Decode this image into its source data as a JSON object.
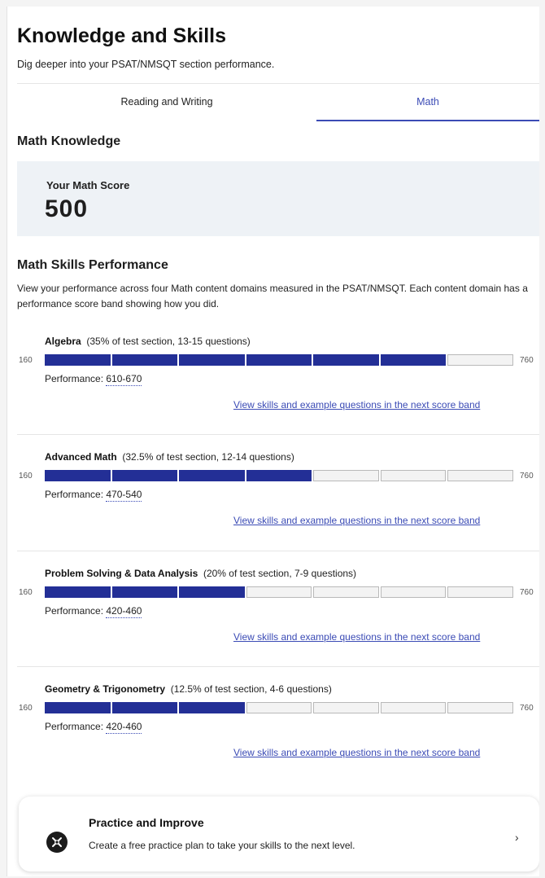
{
  "header": {
    "title": "Knowledge and Skills",
    "subtitle": "Dig deeper into your PSAT/NMSQT section performance."
  },
  "tabs": [
    {
      "label": "Reading and Writing",
      "active": false
    },
    {
      "label": "Math",
      "active": true
    }
  ],
  "math_knowledge": {
    "heading": "Math Knowledge",
    "score_label": "Your Math Score",
    "score_value": "500"
  },
  "skills": {
    "heading": "Math Skills Performance",
    "description": "View your performance across four Math content domains measured in the PSAT/NMSQT. Each content domain has a performance score band showing how you did.",
    "scale_min": "160",
    "scale_max": "760",
    "performance_label": "Performance:",
    "link_text": "View skills and example questions in the next score band",
    "domains": [
      {
        "name": "Algebra",
        "details": "(35% of test section, 13-15 questions)",
        "band": "610-670",
        "filled_segments": 6,
        "total_segments": 7
      },
      {
        "name": "Advanced Math",
        "details": "(32.5% of test section, 12-14 questions)",
        "band": "470-540",
        "filled_segments": 4,
        "total_segments": 7
      },
      {
        "name": "Problem Solving & Data Analysis",
        "details": "(20% of test section, 7-9 questions)",
        "band": "420-460",
        "filled_segments": 3,
        "total_segments": 7
      },
      {
        "name": "Geometry & Trigonometry",
        "details": "(12.5% of test section, 4-6 questions)",
        "band": "420-460",
        "filled_segments": 3,
        "total_segments": 7
      }
    ]
  },
  "practice": {
    "title": "Practice and Improve",
    "subtitle": "Create a free practice plan to take your skills to the next level.",
    "icon": "practice-plan-icon",
    "chevron": "chevron-right-icon"
  },
  "colors": {
    "accent": "#3b4bb5",
    "bar_filled": "#232f96",
    "bar_empty": "#f3f3f3",
    "score_box_bg": "#eef2f6"
  }
}
